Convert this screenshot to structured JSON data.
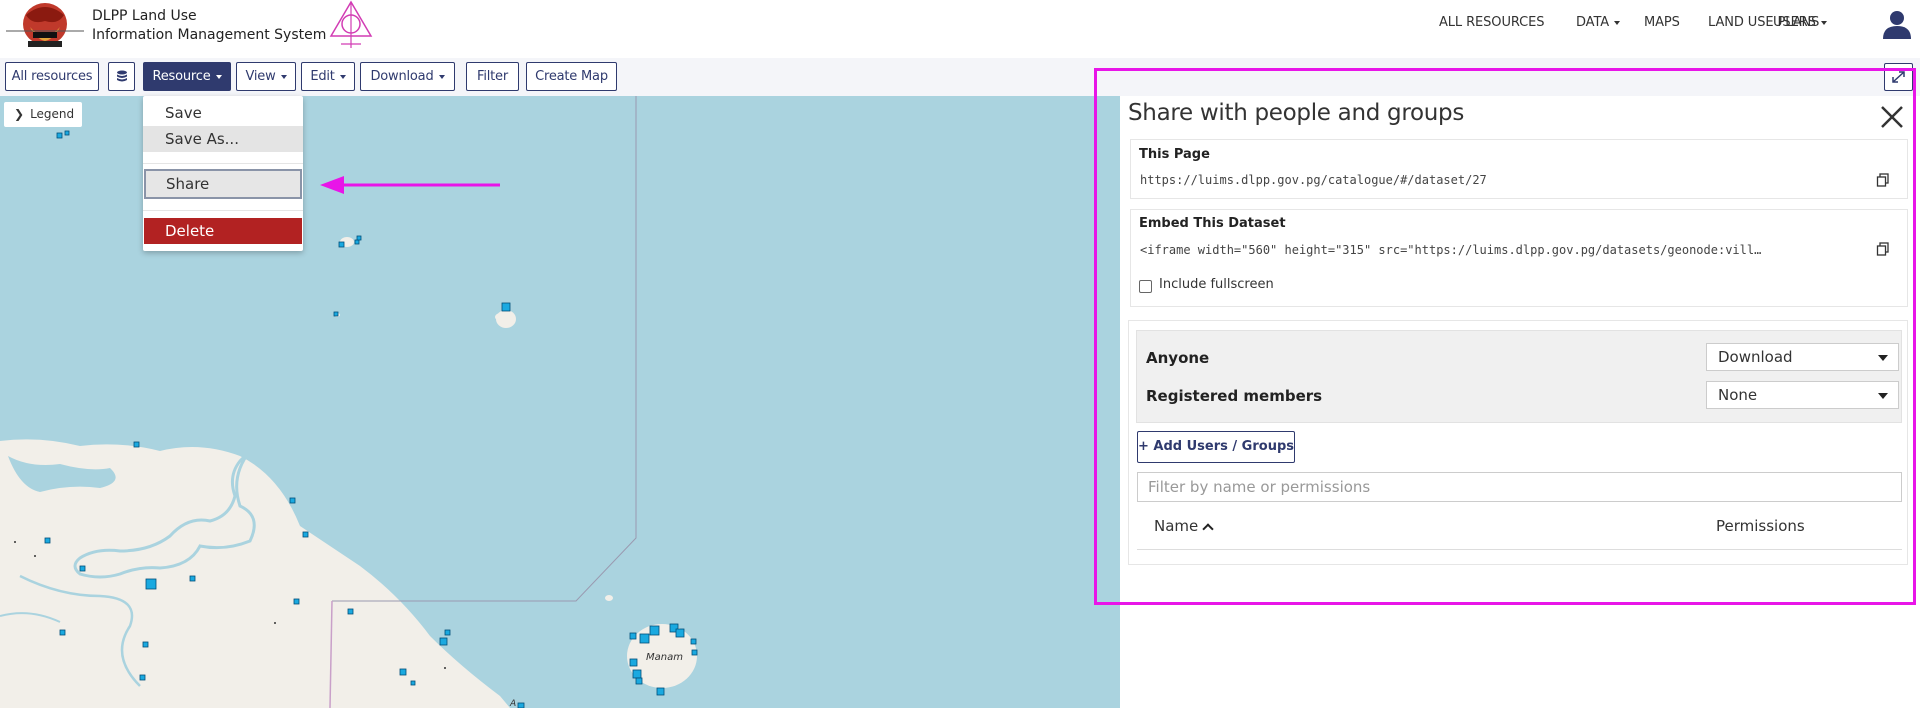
{
  "header": {
    "brand_line1": "DLPP Land Use",
    "brand_line2": "Information Management System",
    "nav": [
      {
        "label": "ALL RESOURCES",
        "dropdown": false
      },
      {
        "label": "DATA",
        "dropdown": true
      },
      {
        "label": "MAPS",
        "dropdown": false
      },
      {
        "label": "LAND USE PLANS",
        "dropdown": false
      },
      {
        "label": "USERS",
        "dropdown": true
      }
    ],
    "user_icon": "user-icon"
  },
  "toolbar": {
    "all_resources": "All resources",
    "layers_icon": "database-icon",
    "resource": "Resource",
    "view": "View",
    "edit": "Edit",
    "download": "Download",
    "filter": "Filter",
    "create_map": "Create Map",
    "expand_icon": "expand-icon"
  },
  "map": {
    "legend": "Legend",
    "place_label": "Manam",
    "place_label_2": "A"
  },
  "resource_menu": {
    "save": "Save",
    "save_as": "Save As...",
    "share": "Share",
    "delete": "Delete"
  },
  "share_panel": {
    "title": "Share with people and groups",
    "this_page_label": "This Page",
    "this_page_url": "https://luims.dlpp.gov.pg/catalogue/#/dataset/27",
    "embed_label": "Embed This Dataset",
    "embed_code": "<iframe width=\"560\" height=\"315\" src=\"https://luims.dlpp.gov.pg/datasets/geonode:vill…",
    "include_fullscreen": "Include fullscreen",
    "permissions": [
      {
        "name": "Anyone",
        "value": "Download"
      },
      {
        "name": "Registered members",
        "value": "None"
      }
    ],
    "add_users": "+ Add Users / Groups",
    "filter_placeholder": "Filter by name or permissions",
    "col_name": "Name",
    "col_permissions": "Permissions"
  },
  "colors": {
    "primary": "#2f3a6e",
    "highlight": "#e815e8",
    "delete": "#b22222",
    "water": "#aad3df",
    "land": "#f2efe9"
  }
}
